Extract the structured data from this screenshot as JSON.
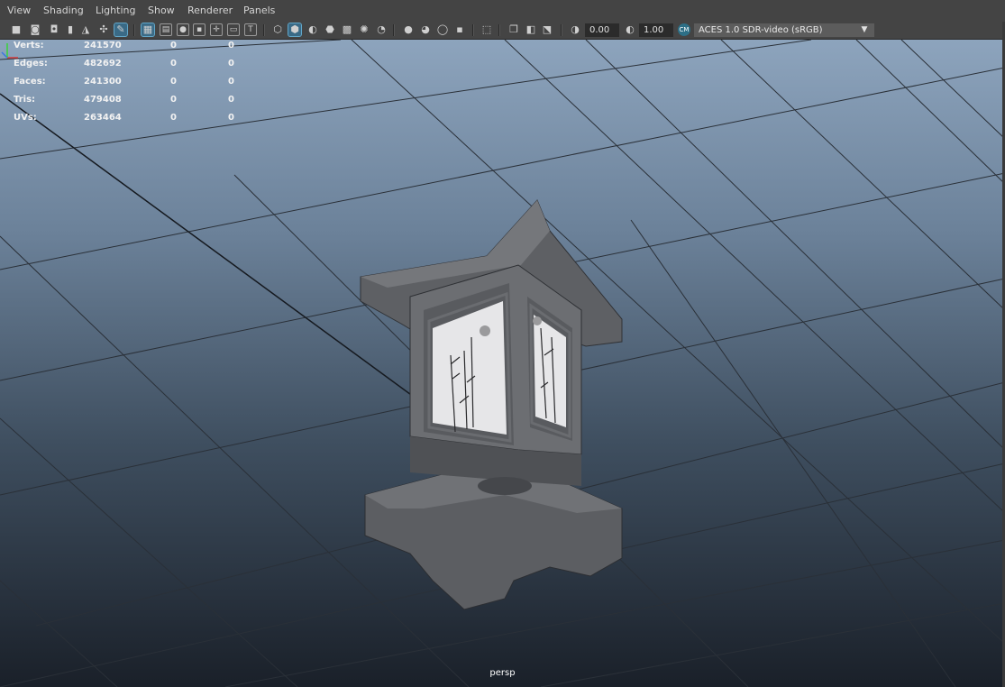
{
  "menubar": {
    "items": [
      {
        "label": "View"
      },
      {
        "label": "Shading"
      },
      {
        "label": "Lighting"
      },
      {
        "label": "Show"
      },
      {
        "label": "Renderer"
      },
      {
        "label": "Panels"
      }
    ]
  },
  "toolbar": {
    "exposure_value": "0.00",
    "gamma_value": "1.00",
    "color_space": "ACES 1.0 SDR-video (sRGB)",
    "icons": [
      "select-camera-icon",
      "camera-attributes-icon",
      "bookmark-icon",
      "image-plane-icon",
      "two-d-pan-zoom-icon",
      "grease-pencil-icon",
      "grid-icon",
      "film-gate-icon",
      "resolution-gate-icon",
      "gate-mask-icon",
      "field-chart-icon",
      "safe-action-icon",
      "safe-title-icon",
      "wireframe-icon",
      "smooth-shade-icon",
      "use-default-material-icon",
      "wireframe-on-shaded-icon",
      "textured-icon",
      "use-all-lights-icon",
      "shadows-icon",
      "screen-space-ao-icon",
      "motion-blur-icon",
      "multisample-aa-icon",
      "depth-of-field-icon",
      "isolate-select-icon",
      "xray-icon",
      "xray-active-components-icon",
      "xray-joints-icon",
      "backface-culling-icon",
      "exposure-icon",
      "gamma-icon",
      "color-management-icon",
      "dropdown-arrow-icon"
    ]
  },
  "hud": {
    "rows": [
      {
        "label": "Verts:",
        "a": "241570",
        "b": "0",
        "c": "0"
      },
      {
        "label": "Edges:",
        "a": "482692",
        "b": "0",
        "c": "0"
      },
      {
        "label": "Faces:",
        "a": "241300",
        "b": "0",
        "c": "0"
      },
      {
        "label": "Tris:",
        "a": "479408",
        "b": "0",
        "c": "0"
      },
      {
        "label": "UVs:",
        "a": "263464",
        "b": "0",
        "c": "0"
      }
    ]
  },
  "viewport": {
    "camera": "persp"
  },
  "colors": {
    "ui_background": "#444444",
    "active_icon": "#3a6a86",
    "grid_line": "#2a3038",
    "axis_x": "#d23a3a",
    "axis_y": "#3ad23a",
    "axis_z": "#3a78e0"
  }
}
